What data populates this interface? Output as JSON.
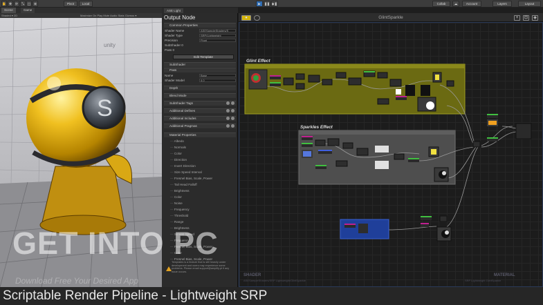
{
  "toolbar": {
    "pivot": "Pivot",
    "local": "Local",
    "collab": "Collab",
    "account": "Account",
    "layers": "Layers",
    "layout": "Layout"
  },
  "scene": {
    "tabs": [
      "Scene",
      "Game"
    ],
    "bar_left": "Shaded  ▾  2D",
    "bar_right": "Maximize On Play   Mute Audio   Stats   Gizmos ▾",
    "logo_text": "unity"
  },
  "inspector": {
    "tab": "ASE Light",
    "title": "Output Node",
    "common_header": "Common Properties",
    "rows": [
      {
        "label": "Shader Name",
        "value": "ASESampleShaders/S"
      },
      {
        "label": "Shader Type",
        "value": "SRP/Lightweight"
      },
      {
        "label": "Precision",
        "value": "Float"
      },
      {
        "label": "SubShader 0",
        "value": ""
      },
      {
        "label": "Pass 0",
        "value": ""
      }
    ],
    "edit_button": "Edit Template",
    "subshader": "SubShader",
    "pass": "Pass",
    "pass_rows": [
      {
        "label": "Name",
        "value": "Base"
      },
      {
        "label": "Shader Model",
        "value": "4.0"
      }
    ],
    "sections": [
      "Depth",
      "Blend Mode",
      "SubShader Tags",
      "Additional Defines",
      "Additional Includes",
      "Additional Pragmas"
    ],
    "material_header": "Material Properties",
    "properties": [
      "Albedo",
      "Normals",
      "Color",
      "Direction",
      "Invert Direction",
      "Size Speed Interval",
      "Fresnel Bias, Scale, Power",
      "Tail Head Falloff",
      "Brightness",
      "Color",
      "Noise",
      "Frequency",
      "Threshold",
      "Range",
      "Brightness",
      "Screen Speed",
      "Frequency",
      "Fresnel Bias, Scale, Power",
      "Color",
      "Fresnel Bias, Scale, Power"
    ],
    "warning": "Templates is a feature that is still heavily under development and users may experience some problems. Please email support@amplify.pt if any issue occurs."
  },
  "graph": {
    "title": "GlintSparkle",
    "group_glint": "Glint Effect",
    "group_sparkles": "Sparkles Effect",
    "shader_label": "SHADER",
    "shader_path": "ASESampleShaders/SRP Lightweight/GlintSparkle",
    "material_label": "MATERIAL",
    "material_path": "SRP Lightweight GlintSparkle",
    "colors": {
      "glint_group": "#6b6a12",
      "sparkles_group": "#4e4e4e",
      "node": "#3a3a3a",
      "accent_blue": "#1f3f9a"
    }
  },
  "watermark": {
    "main": "GET INTO PC",
    "sub": "Download Free Your Desired App"
  },
  "caption": "Scriptable Render Pipeline - Lightweight SRP"
}
